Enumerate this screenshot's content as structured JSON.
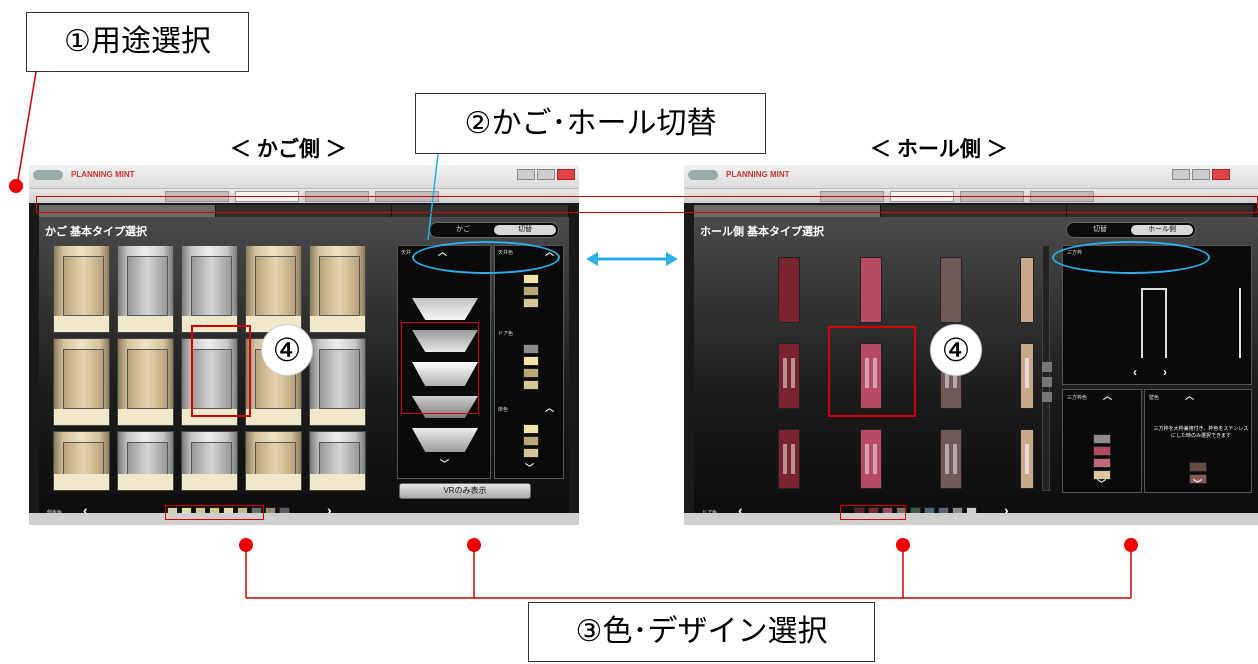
{
  "callouts": {
    "usage": "①用途選択",
    "switch": "②かご･ホール切替",
    "color_design": "③色･デザイン選択",
    "num4": "④"
  },
  "titles": {
    "cage_side": "＜ かご側 ＞",
    "hall_side": "＜ ホール側 ＞"
  },
  "app": {
    "brand": "PLANNING MINT",
    "nav_tabs": [
      "",
      "",
      "",
      ""
    ],
    "category_tabs": [
      "",
      "",
      ""
    ]
  },
  "cage_panel": {
    "heading": "かご 基本タイプ選択",
    "toggle": [
      "かご",
      "切替"
    ],
    "ceiling_label": "天井",
    "ceiling_color_label": "天井色",
    "door_color_label": "ドア色",
    "floor_color_label": "床色",
    "wall_label": "側板色",
    "vr_button": "VRのみ表示"
  },
  "hall_panel": {
    "heading": "ホール側 基本タイプ選択",
    "toggle": [
      "切替",
      "ホール側"
    ],
    "frame_label": "三方枠",
    "frame_color_label": "三方枠色",
    "wall_color_label": "壁色",
    "door_color_label": "ドア色",
    "notice": "三方枠を大枠兼用付き、枠色をステンレスにした時のみ選択できます"
  },
  "colors": {
    "frame_red": "#d40000",
    "cyan": "#2ab0e6",
    "wall_swatches": [
      "#d9d2b0",
      "#e6dbad",
      "#cfc49a",
      "#d8c98c",
      "#e9dcb0",
      "#c9b88b",
      "#6b6b6b",
      "#9a8c70",
      "#5c5c5c"
    ],
    "door_swatches": [
      "#5e2228",
      "#7a2a35",
      "#9c4a5e",
      "#7d6f6a",
      "#3c5e45",
      "#4a6c78",
      "#5a5f7a",
      "#8a8a8a",
      "#cfcfcf"
    ],
    "ceiling_color_swatches": [
      "#efe3a8",
      "#b9a97a",
      "#d9c79c"
    ],
    "door_color_swatches": [
      "#8c8c8c",
      "#efe3a8",
      "#b9a97a",
      "#d9c79c"
    ],
    "floor_color_swatches": [
      "#efe3a8",
      "#b9a97a",
      "#d9c79c"
    ],
    "hall_frame_swatches": [
      "#8c8c8c",
      "#b04a5e",
      "#c26a7a",
      "#d9c79c"
    ],
    "hall_wall_swatches": [
      "#6a4a45",
      "#8a5a55"
    ]
  },
  "icons": {
    "left_arrow": "‹",
    "right_arrow": "›",
    "up_arrow": "︿",
    "down_arrow": "﹀",
    "switch_arrow": "double-arrow-icon"
  }
}
